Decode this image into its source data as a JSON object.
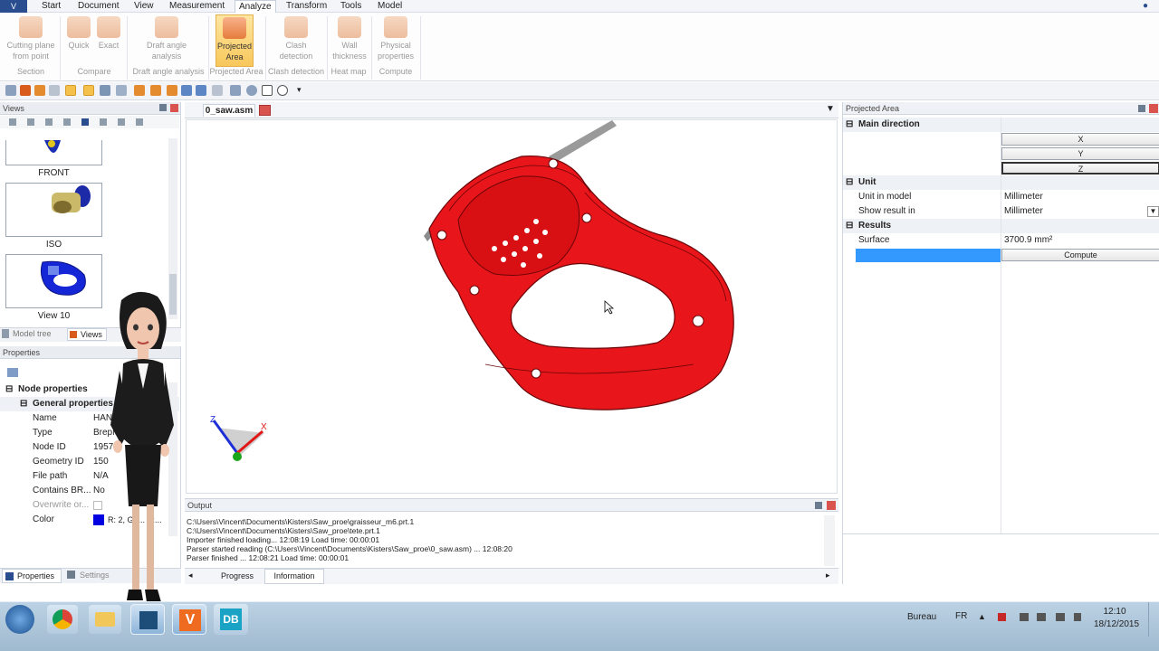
{
  "menubar": {
    "app_button": "V",
    "items": [
      "Start",
      "Document",
      "View",
      "Measurement",
      "Analyze",
      "Transform",
      "Tools",
      "Model"
    ],
    "active": "Analyze"
  },
  "ribbon": {
    "buttons": [
      {
        "label": "Cutting plane from point",
        "icon": "cutting-plane-icon"
      },
      {
        "label": "Quick",
        "icon": "compare-quick-icon"
      },
      {
        "label": "Exact",
        "icon": "compare-exact-icon"
      },
      {
        "label": "Draft angle analysis",
        "icon": "draft-angle-icon"
      },
      {
        "label": "Projected Area",
        "icon": "projected-area-icon",
        "active": true
      },
      {
        "label": "Clash detection",
        "icon": "clash-detection-icon"
      },
      {
        "label": "Wall thickness",
        "icon": "wall-thickness-icon"
      },
      {
        "label": "Physical properties",
        "icon": "physical-properties-icon"
      }
    ],
    "groups": [
      "Section",
      "Compare",
      "Draft angle analysis",
      "Projected Area",
      "Clash detection",
      "Heat map",
      "Compute"
    ]
  },
  "views_panel": {
    "title": "Views",
    "items": [
      {
        "label": "FRONT"
      },
      {
        "label": "ISO"
      },
      {
        "label": "View 10"
      }
    ],
    "tabs": [
      "Model tree",
      "Views"
    ]
  },
  "properties": {
    "title": "Properties",
    "section": "Node properties",
    "subsection": "General properties",
    "rows": [
      {
        "key": "Name",
        "value": "HAN..."
      },
      {
        "key": "Type",
        "value": "BrepMo..."
      },
      {
        "key": "Node ID",
        "value": "1957"
      },
      {
        "key": "Geometry ID",
        "value": "150"
      },
      {
        "key": "File path",
        "value": "N/A"
      },
      {
        "key": "Contains BR...",
        "value": "No"
      },
      {
        "key": "Overwrite or...",
        "value": ""
      },
      {
        "key": "Color",
        "value": "R: 2, G: ... B:..."
      }
    ],
    "color_swatch": "#0000e0",
    "tabs": [
      "Properties",
      "Settings"
    ]
  },
  "document": {
    "tab": "0_saw.asm",
    "model_color": "#e8161a"
  },
  "output": {
    "title": "Output",
    "lines": [
      "C:\\Users\\Vincent\\Documents\\Kisters\\Saw_proe\\graisseur_m6.prt.1",
      "C:\\Users\\Vincent\\Documents\\Kisters\\Saw_proe\\tete.prt.1",
      "Importer finished loading... 12:08:19 Load time: 00:00:01",
      "Parser started reading (C:\\Users\\Vincent\\Documents\\Kisters\\Saw_proe\\0_saw.asm) ... 12:08:20",
      "Parser finished ... 12:08:21 Load time: 00:00:01"
    ],
    "tabs": [
      "Progress",
      "Information"
    ]
  },
  "right_panel": {
    "title": "Projected Area",
    "main_direction": {
      "label": "Main direction",
      "buttons": [
        "X",
        "Y",
        "Z"
      ]
    },
    "unit": {
      "label": "Unit",
      "rows": [
        {
          "key": "Unit in model",
          "value": "Millimeter"
        },
        {
          "key": "Show result in",
          "value": "Millimeter"
        }
      ]
    },
    "results": {
      "label": "Results",
      "surface_key": "Surface",
      "surface_value": "3700.9 mm²",
      "compute_label": "Compute"
    }
  },
  "taskbar": {
    "apps": [
      "start-orb-icon",
      "chrome-icon",
      "folder-icon",
      "app-icon",
      "vincent-app-icon",
      "db-app-icon"
    ],
    "tray_label": "Bureau",
    "lang": "FR",
    "time": "12:10",
    "date": "18/12/2015"
  }
}
